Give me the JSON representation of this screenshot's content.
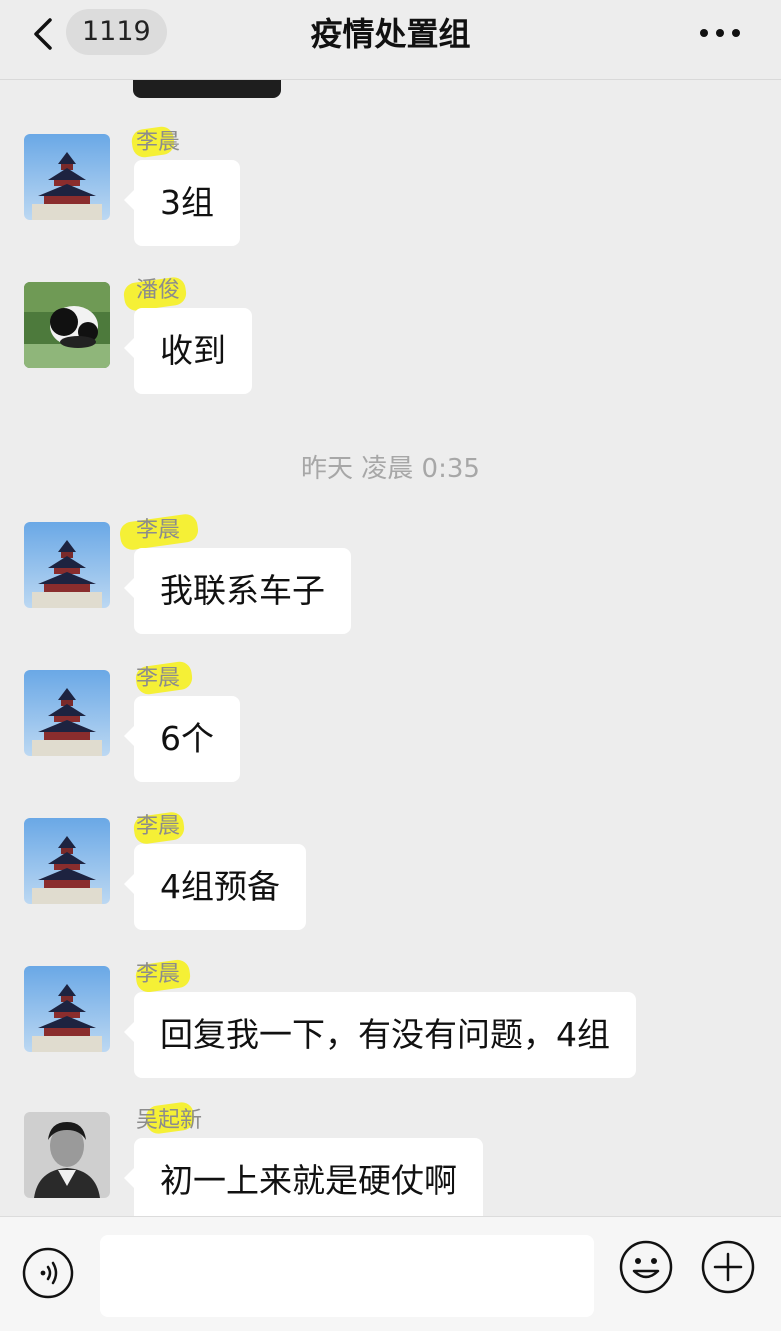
{
  "header": {
    "title": "疫情处置组",
    "unread_count": "1119"
  },
  "timestamp": "昨天 凌晨 0:35",
  "messages": [
    {
      "sender": "李晨",
      "avatar": "temple-avatar",
      "text": "3组"
    },
    {
      "sender": "潘俊",
      "avatar": "panda-avatar",
      "text": "收到"
    },
    {
      "sender": "李晨",
      "avatar": "temple-avatar",
      "text": "我联系车子"
    },
    {
      "sender": "李晨",
      "avatar": "temple-avatar",
      "text": "6个"
    },
    {
      "sender": "李晨",
      "avatar": "temple-avatar",
      "text": "4组预备"
    },
    {
      "sender": "李晨",
      "avatar": "temple-avatar",
      "text": "回复我一下，有没有问题，4组"
    },
    {
      "sender": "吴起新",
      "avatar": "portrait-avatar",
      "text": "初一上来就是硬仗啊"
    }
  ],
  "footer": {
    "input_value": "",
    "icons": [
      "voice-icon",
      "emoji-icon",
      "plus-icon"
    ]
  },
  "colors": {
    "background": "#ededed",
    "bubble": "#ffffff",
    "highlight": "#f5ef21"
  }
}
